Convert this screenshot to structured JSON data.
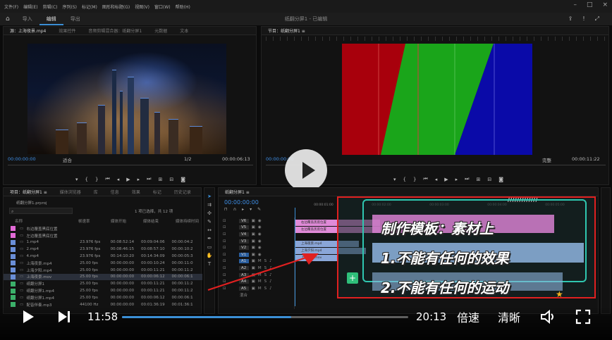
{
  "menubar": {
    "items": [
      "文件(F)",
      "编辑(E)",
      "剪辑(C)",
      "序列(S)",
      "标记(M)",
      "图形和标题(G)",
      "视图(V)",
      "窗口(W)",
      "帮助(H)"
    ]
  },
  "workspace": {
    "tabs": [
      "导入",
      "编辑",
      "导出"
    ],
    "active": "编辑",
    "title": "纸翻分屏1 - 已编辑"
  },
  "source_panel": {
    "tabs": [
      "源：上海夜景.mp4",
      "效果控件",
      "音频剪辑混合器：纸翻分屏1",
      "元数据",
      "文本"
    ],
    "timecode_in": "00:00:00:00",
    "fit": "适合",
    "ratio": "1/2",
    "timecode_out": "00:00:06:13"
  },
  "program_panel": {
    "tab": "节目：纸翻分屏1 ≡",
    "timecode_in": "00:00:00:00",
    "fit": "完整",
    "timecode_out": "00:00:11:22"
  },
  "project_panel": {
    "tabs": [
      "项目：纸翻分屏1 ≡",
      "媒体浏览器",
      "库",
      "信息",
      "效果",
      "标记",
      "历史记录"
    ],
    "file": "纸翻分屏1.prproj",
    "selection_info": "1 项已选择，共 12 项",
    "headers": [
      "名称",
      "帧速率",
      "媒体开始",
      "媒体结束",
      "媒体持续时间"
    ],
    "rows": [
      {
        "name": "右边覆盖黑底位置",
        "fps": "",
        "start": "",
        "end": "",
        "dur": "",
        "color": "#e26ad6"
      },
      {
        "name": "左边覆盖黑底位置",
        "fps": "",
        "start": "",
        "end": "",
        "dur": "",
        "color": "#e26ad6"
      },
      {
        "name": "1.mp4",
        "fps": "23.976 fps",
        "start": "00:08:52:14",
        "end": "00:09:04:06",
        "dur": "00:00:04:2",
        "color": "#6a8fd8"
      },
      {
        "name": "2.mp4",
        "fps": "23.976 fps",
        "start": "00:08:46:15",
        "end": "00:08:57:10",
        "dur": "00:00:10:2",
        "color": "#6a8fd8"
      },
      {
        "name": "4.mp4",
        "fps": "23.976 fps",
        "start": "00:14:10:20",
        "end": "00:14:34:09",
        "dur": "00:00:05:3",
        "color": "#6a8fd8"
      },
      {
        "name": "上海夜景.mp4",
        "fps": "25.00 fps",
        "start": "00:00:00:00",
        "end": "00:00:10:24",
        "dur": "00:00:11:0",
        "color": "#6a8fd8"
      },
      {
        "name": "上海夕阳.mp4",
        "fps": "25.00 fps",
        "start": "00:00:00:00",
        "end": "00:00:11:21",
        "dur": "00:00:11:2",
        "color": "#6a8fd8"
      },
      {
        "name": "上海夜景.mov",
        "fps": "25.00 fps",
        "start": "00:00:00:00",
        "end": "00:00:06:12",
        "dur": "00:00:06:1",
        "color": "#6a8fd8"
      },
      {
        "name": "纸翻分屏1",
        "fps": "25.00 fps",
        "start": "00:00:00:00",
        "end": "00:00:11:21",
        "dur": "00:00:11:2",
        "color": "#3bb06a"
      },
      {
        "name": "纸翻分屏1.mp4",
        "fps": "25.00 fps",
        "start": "00:00:00:00",
        "end": "00:00:11:21",
        "dur": "00:00:11:2",
        "color": "#3bb06a"
      },
      {
        "name": "纸翻分屏1.mp4",
        "fps": "25.00 fps",
        "start": "00:00:00:00",
        "end": "00:00:06:12",
        "dur": "00:00:06:1",
        "color": "#3bb06a"
      },
      {
        "name": "配音伴奏.mp3",
        "fps": "44100 Hz",
        "start": "00:00:00:00",
        "end": "00:01:36:19",
        "dur": "00:01:36:1",
        "color": "#3bb06a"
      }
    ]
  },
  "timeline": {
    "tab": "纸翻分屏1 ≡",
    "timecode": "00:00:00:00",
    "ruler": [
      "00:00:01:00",
      "00:00:02:00",
      "00:00:03:00",
      "00:00:04:00",
      "00:00:05:00"
    ],
    "tracks": [
      "V6",
      "V5",
      "V4",
      "V3",
      "V2",
      "V1",
      "A1",
      "A2",
      "A3",
      "A4",
      "A5"
    ],
    "master": "混合",
    "clips": [
      "右边覆盖黑底位置",
      "左边覆盖黑底位置",
      "上海夜景.mp4",
      "上海夕阳.mp4",
      "上海夜景.mov"
    ]
  },
  "overlay": {
    "title": "制作模板：素材上",
    "line1": "1.不能有任何的效果",
    "line2": "2.不能有任何的运动",
    "plus": "+",
    "star": "★",
    "stripes": "/////////////"
  },
  "player": {
    "current": "11:58",
    "total": "20:13",
    "speed": "倍速",
    "quality": "清晰",
    "progress": 0.592,
    "play_icon": "play-icon"
  },
  "colors": {
    "accent": "#3b8fd6",
    "red": "#a8000c",
    "green": "#1aa51a",
    "blue": "#0a0aa8",
    "annot": "#e02020"
  }
}
